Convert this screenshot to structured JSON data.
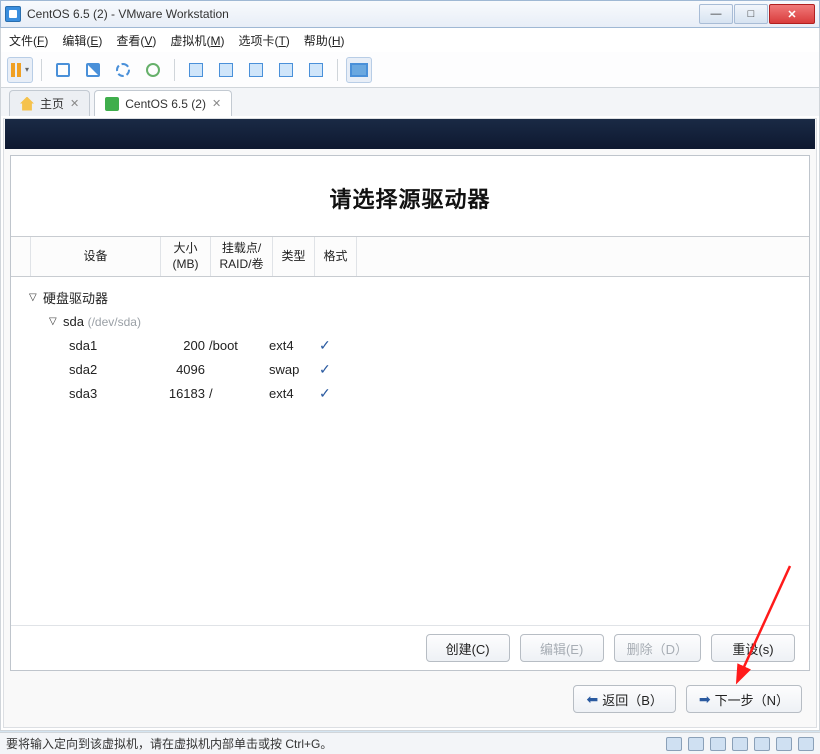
{
  "window": {
    "title": "CentOS 6.5 (2) - VMware Workstation"
  },
  "menu": {
    "file": "文件",
    "fileKey": "F",
    "edit": "编辑",
    "editKey": "E",
    "view": "查看",
    "viewKey": "V",
    "vm": "虚拟机",
    "vmKey": "M",
    "tabs": "选项卡",
    "tabsKey": "T",
    "help": "帮助",
    "helpKey": "H"
  },
  "tabs": {
    "home": "主页",
    "vmname": "CentOS 6.5 (2)"
  },
  "installer": {
    "heading": "请选择源驱动器",
    "columns": {
      "device": "设备",
      "size": "大小\n(MB)",
      "mount": "挂载点/\nRAID/卷",
      "type": "类型",
      "format": "格式"
    },
    "root_label": "硬盘驱动器",
    "disk_name": "sda",
    "disk_path": "(/dev/sda)",
    "partitions": [
      {
        "name": "sda1",
        "size": "200",
        "mount": "/boot",
        "type": "ext4",
        "format": "✓"
      },
      {
        "name": "sda2",
        "size": "4096",
        "mount": "",
        "type": "swap",
        "format": "✓"
      },
      {
        "name": "sda3",
        "size": "16183",
        "mount": "/",
        "type": "ext4",
        "format": "✓"
      }
    ],
    "buttons": {
      "create": "创建(C)",
      "edit": "编辑(E)",
      "delete": "删除（D）",
      "reset": "重设(s)",
      "back": "返回（B）",
      "next": "下一步（N）"
    }
  },
  "status": {
    "text": "要将输入定向到该虚拟机，请在虚拟机内部单击或按 Ctrl+G。"
  }
}
